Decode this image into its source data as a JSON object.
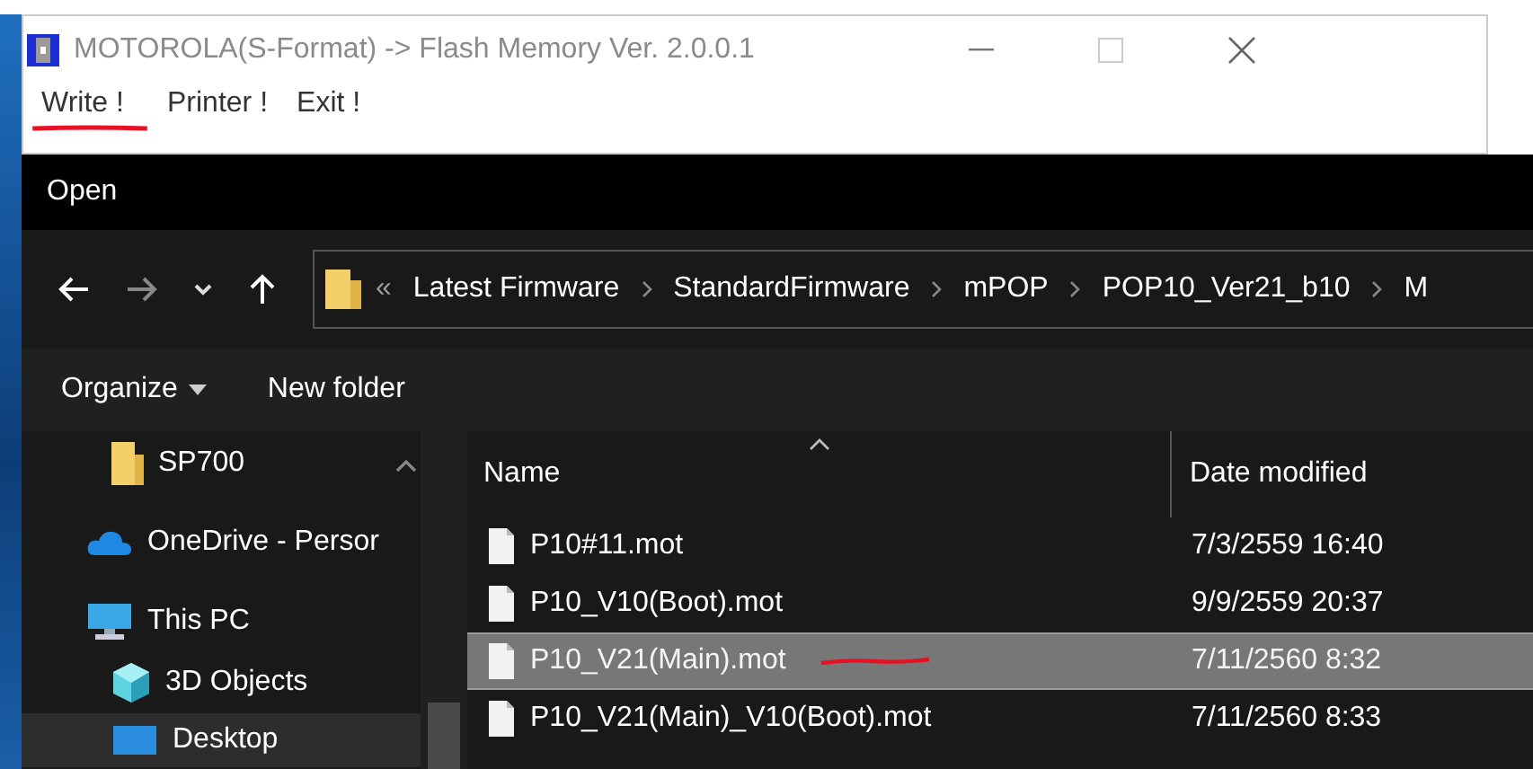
{
  "app_window": {
    "title": "MOTOROLA(S-Format) -> Flash Memory Ver. 2.0.0.1",
    "menu": [
      {
        "label": "Write !",
        "annotated": true
      },
      {
        "label": "Printer !",
        "annotated": false
      },
      {
        "label": "Exit !",
        "annotated": false
      }
    ]
  },
  "dialog": {
    "title": "Open",
    "breadcrumbs": [
      "«",
      "Latest Firmware",
      "StandardFirmware",
      "mPOP",
      "POP10_Ver21_b10",
      "M"
    ],
    "toolbar": [
      {
        "label": "Organize",
        "dropdown": true
      },
      {
        "label": "New folder",
        "dropdown": false
      }
    ],
    "sidebar": {
      "items": [
        {
          "children": [
            {
              "label": "SP700",
              "kind": "folder",
              "selected": false
            }
          ]
        },
        {
          "label": "OneDrive - Persor",
          "kind": "cloud",
          "selected": false
        },
        {
          "label": "This PC",
          "kind": "pc",
          "selected": false,
          "children": [
            {
              "label": "3D Objects",
              "kind": "cube",
              "selected": false
            },
            {
              "label": "Desktop",
              "kind": "desktop",
              "selected": true
            }
          ]
        }
      ]
    },
    "columns": [
      {
        "label": "Name",
        "sorted": true
      },
      {
        "label": "Date modified",
        "sorted": false
      }
    ],
    "files": [
      {
        "name": "P10#11.mot",
        "date": "7/3/2559 16:40",
        "selected": false,
        "annotated": false
      },
      {
        "name": "P10_V10(Boot).mot",
        "date": "9/9/2559 20:37",
        "selected": false,
        "annotated": false
      },
      {
        "name": "P10_V21(Main).mot",
        "date": "7/11/2560 8:32",
        "selected": true,
        "annotated": true
      },
      {
        "name": "P10_V21(Main)_V10(Boot).mot",
        "date": "7/11/2560 8:33",
        "selected": false,
        "annotated": false
      }
    ]
  }
}
